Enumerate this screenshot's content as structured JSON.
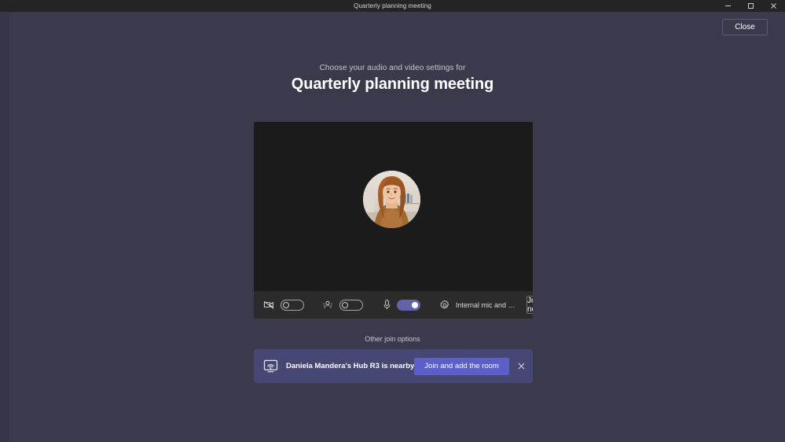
{
  "window": {
    "title": "Quarterly planning meeting",
    "controls": {
      "minimize_icon": "minimize-icon",
      "maximize_icon": "maximize-icon",
      "close_icon": "close-icon"
    }
  },
  "header": {
    "close_label": "Close"
  },
  "prejoin": {
    "subtitle": "Choose your audio and video settings for",
    "title": "Quarterly planning meeting"
  },
  "preview": {
    "avatar_name": "participant-avatar"
  },
  "controls": {
    "camera": {
      "icon": "camera-off-icon",
      "toggle_state": "off"
    },
    "background_effects": {
      "icon": "background-blur-icon",
      "toggle_state": "off"
    },
    "microphone": {
      "icon": "microphone-icon",
      "toggle_state": "on"
    },
    "device_settings": {
      "icon": "settings-gear-icon",
      "label": "Internal mic and spe..."
    },
    "join_label": "Join now"
  },
  "other_join": {
    "label": "Other join options"
  },
  "nearby_banner": {
    "icon": "cast-screen-icon",
    "message": "Daniela Mandera's Hub R3 is nearby",
    "action_label": "Join and add the room",
    "dismiss_icon": "close-icon"
  },
  "colors": {
    "app_background": "#3b3a4c",
    "titlebar": "#242424",
    "preview_background": "#1b1b1b",
    "control_bar": "#2b2b2b",
    "toggle_on": "#6264a7",
    "banner_background": "#464775",
    "banner_button": "#5b5fc7"
  }
}
